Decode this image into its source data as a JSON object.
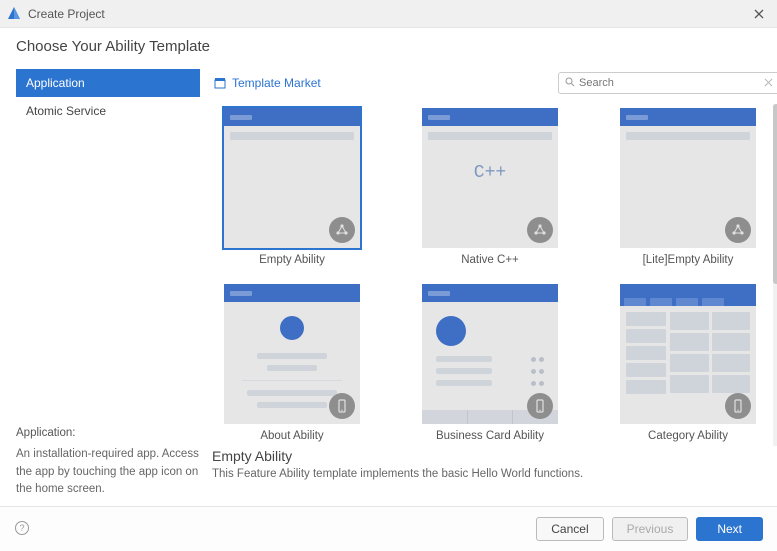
{
  "titlebar": {
    "title": "Create Project"
  },
  "heading": "Choose Your Ability Template",
  "categories": [
    {
      "label": "Application",
      "selected": true
    },
    {
      "label": "Atomic Service",
      "selected": false
    }
  ],
  "category_desc": {
    "title": "Application:",
    "text": "An installation-required app. Access the app by touching the app icon on the home screen."
  },
  "template_market_label": "Template Market",
  "search": {
    "placeholder": "Search"
  },
  "templates": [
    {
      "label": "Empty Ability",
      "kind": "empty",
      "badge": "network",
      "selected": true
    },
    {
      "label": "Native C++",
      "kind": "cpp",
      "badge": "network",
      "selected": false
    },
    {
      "label": "[Lite]Empty Ability",
      "kind": "empty",
      "badge": "network",
      "selected": false
    },
    {
      "label": "About Ability",
      "kind": "about",
      "badge": "phone",
      "selected": false
    },
    {
      "label": "Business Card Ability",
      "kind": "business",
      "badge": "phone",
      "selected": false
    },
    {
      "label": "Category Ability",
      "kind": "category",
      "badge": "phone",
      "selected": false
    }
  ],
  "selected_template": {
    "title": "Empty Ability",
    "description": "This Feature Ability template implements the basic Hello World functions."
  },
  "footer": {
    "cancel": "Cancel",
    "previous": "Previous",
    "next": "Next"
  }
}
